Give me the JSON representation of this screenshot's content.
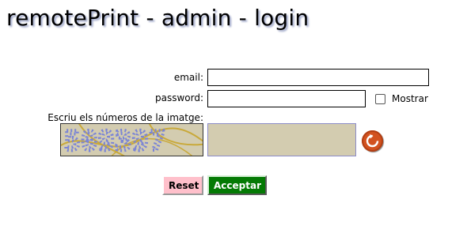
{
  "page": {
    "title": "remotePrint - admin - login"
  },
  "form": {
    "email_label": "email:",
    "email_value": "",
    "password_label": "password:",
    "password_value": "",
    "show_password_label": "Mostrar",
    "show_password_checked": false,
    "captcha_label": "Escriu els números de la imatge:",
    "captcha_image_text": "509397",
    "captcha_value": ""
  },
  "buttons": {
    "reset_label": "Reset",
    "accept_label": "Acceptar"
  },
  "icons": {
    "refresh": "refresh-icon"
  },
  "colors": {
    "captcha_bg": "#d3ccb0",
    "captcha_digits": "#7a84d6",
    "refresh_button": "#d2521f",
    "reset_button": "#ffc0cb",
    "accept_button": "#047a04"
  }
}
